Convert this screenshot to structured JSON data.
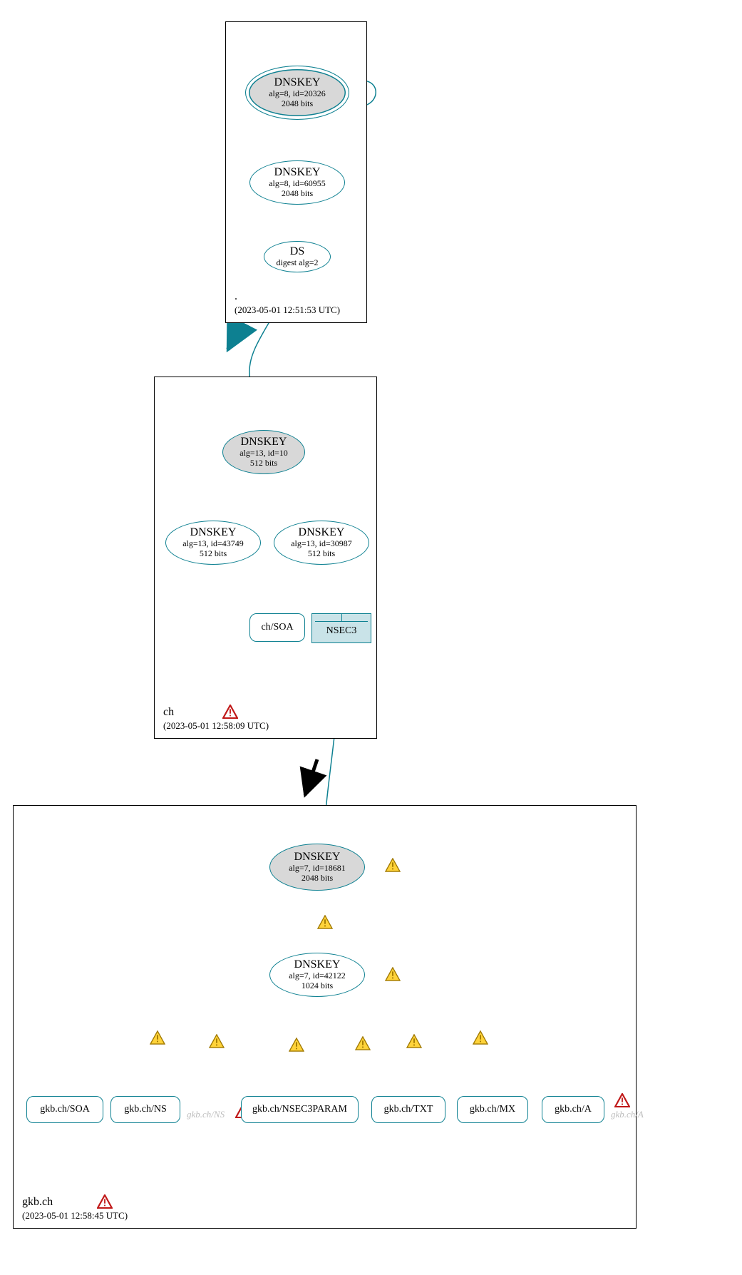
{
  "zones": {
    "root": {
      "name": ".",
      "timestamp": "(2023-05-01 12:51:53 UTC)",
      "nodes": {
        "dnskey_20326": {
          "title": "DNSKEY",
          "line2": "alg=8, id=20326",
          "line3": "2048 bits"
        },
        "dnskey_60955": {
          "title": "DNSKEY",
          "line2": "alg=8, id=60955",
          "line3": "2048 bits"
        },
        "ds": {
          "title": "DS",
          "line2": "digest alg=2"
        }
      }
    },
    "ch": {
      "name": "ch",
      "timestamp": "(2023-05-01 12:58:09 UTC)",
      "nodes": {
        "dnskey_10": {
          "title": "DNSKEY",
          "line2": "alg=13, id=10",
          "line3": "512 bits"
        },
        "dnskey_43749": {
          "title": "DNSKEY",
          "line2": "alg=13, id=43749",
          "line3": "512 bits"
        },
        "dnskey_30987": {
          "title": "DNSKEY",
          "line2": "alg=13, id=30987",
          "line3": "512 bits"
        },
        "soa": {
          "label": "ch/SOA"
        },
        "nsec3": {
          "label": "NSEC3"
        }
      }
    },
    "gkb": {
      "name": "gkb.ch",
      "timestamp": "(2023-05-01 12:58:45 UTC)",
      "nodes": {
        "dnskey_18681": {
          "title": "DNSKEY",
          "line2": "alg=7, id=18681",
          "line3": "2048 bits"
        },
        "dnskey_42122": {
          "title": "DNSKEY",
          "line2": "alg=7, id=42122",
          "line3": "1024 bits"
        },
        "rr": {
          "soa": "gkb.ch/SOA",
          "ns": "gkb.ch/NS",
          "nsec3param": "gkb.ch/NSEC3PARAM",
          "txt": "gkb.ch/TXT",
          "mx": "gkb.ch/MX",
          "a": "gkb.ch/A"
        },
        "ghosts": {
          "ns": "gkb.ch/NS",
          "a": "gkb.ch/A"
        }
      }
    }
  },
  "icons": {
    "warn": "warning-triangle-yellow",
    "error": "warning-triangle-red"
  },
  "colors": {
    "teal": "#0d8091",
    "grey_fill": "#d8d8d8",
    "nsec3_fill": "#c9e3e8",
    "warn_fill": "#ffd33a",
    "warn_stroke": "#a07800",
    "error_stroke": "#c01818"
  }
}
